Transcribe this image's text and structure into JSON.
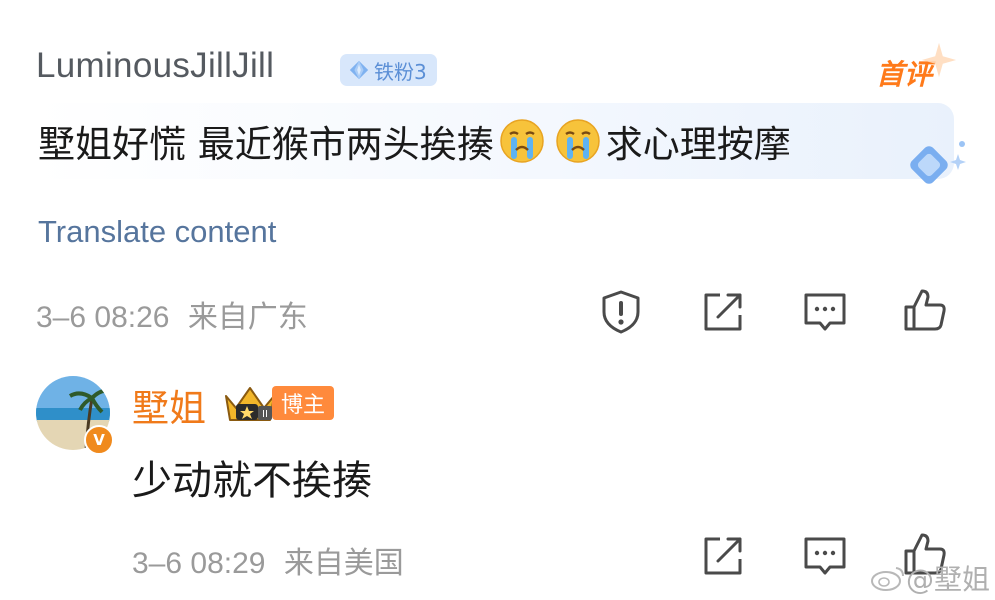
{
  "comment": {
    "username": "LuminousJillJill",
    "fan_badge": "铁粉3",
    "first_badge": "首评",
    "text_part1": "墅姐好慌 最近猴市两头挨揍",
    "text_part2": "求心理按摩",
    "emojis": [
      "crying-emoji",
      "crying-emoji"
    ],
    "translate_label": "Translate content",
    "timestamp": "3–6 08:26",
    "location": "来自广东",
    "actions": [
      "report-icon",
      "share-icon",
      "comment-icon",
      "like-icon"
    ]
  },
  "reply": {
    "username": "墅姐",
    "badge": "博主",
    "level_label": "II",
    "verified_mark": "V",
    "text": "少动就不挨揍",
    "timestamp": "3–6 08:29",
    "location": "来自美国",
    "actions": [
      "share-icon",
      "comment-icon",
      "like-icon"
    ]
  },
  "watermark": "@墅姐",
  "colors": {
    "username": "#555a60",
    "blogger_name": "#f07a1a",
    "link": "#56759d",
    "meta": "#9a9a9a",
    "badge_bg": "#d8e7fb",
    "first_badge": "#ff7a1a"
  }
}
